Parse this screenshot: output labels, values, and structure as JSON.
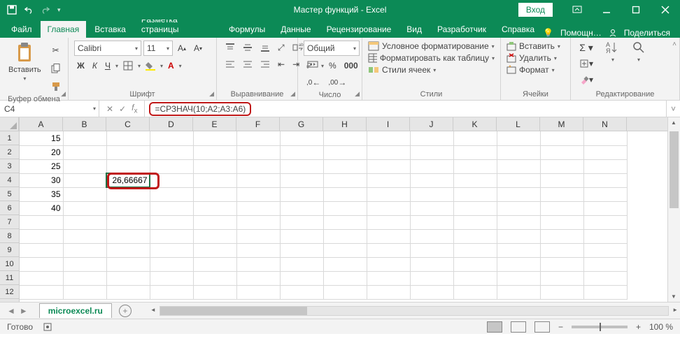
{
  "title": "Мастер функций  -  Excel",
  "login": "Вход",
  "menus": [
    "Файл",
    "Главная",
    "Вставка",
    "Разметка страницы",
    "Формулы",
    "Данные",
    "Рецензирование",
    "Вид",
    "Разработчик",
    "Справка"
  ],
  "menuRight": {
    "help": "Помощн…",
    "share": "Поделиться"
  },
  "ribbon": {
    "clipboard": {
      "paste": "Вставить",
      "label": "Буфер обмена"
    },
    "font": {
      "name": "Calibri",
      "size": "11",
      "label": "Шрифт",
      "bold": "Ж",
      "italic": "К",
      "underline": "Ч"
    },
    "align": {
      "label": "Выравнивание"
    },
    "number": {
      "format": "Общий",
      "label": "Число"
    },
    "styles": {
      "cond": "Условное форматирование",
      "table": "Форматировать как таблицу",
      "cell": "Стили ячеек",
      "label": "Стили"
    },
    "cells": {
      "insert": "Вставить",
      "delete": "Удалить",
      "format": "Формат",
      "label": "Ячейки"
    },
    "editing": {
      "label": "Редактирование"
    }
  },
  "nameBox": "C4",
  "formula": "=СРЗНАЧ(10;A2;A3:A6)",
  "cols": [
    "A",
    "B",
    "C",
    "D",
    "E",
    "F",
    "G",
    "H",
    "I",
    "J",
    "K",
    "L",
    "M",
    "N"
  ],
  "rows": [
    "1",
    "2",
    "3",
    "4",
    "5",
    "6",
    "7",
    "8",
    "9",
    "10",
    "11",
    "12"
  ],
  "cells": {
    "A1": "15",
    "A2": "20",
    "A3": "25",
    "A4": "30",
    "A5": "35",
    "A6": "40",
    "C4": "26,66667"
  },
  "sheetTab": "microexcel.ru",
  "status": {
    "ready": "Готово",
    "zoom": "100 %"
  }
}
